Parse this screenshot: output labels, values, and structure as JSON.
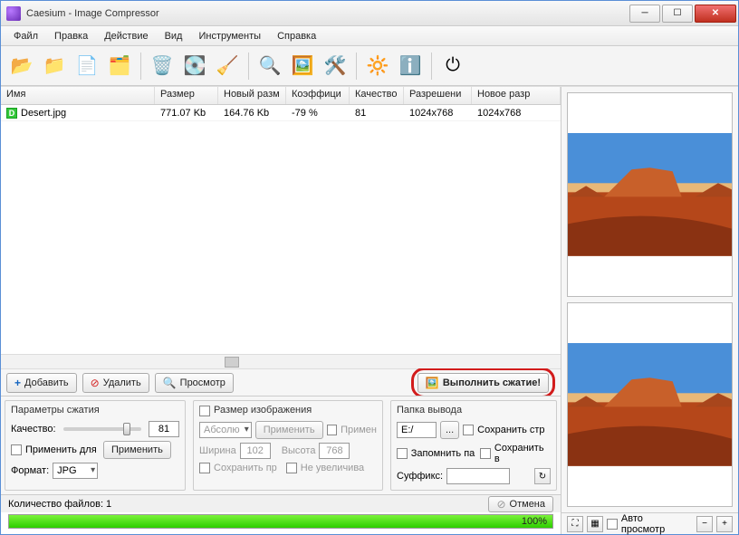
{
  "window": {
    "title": "Caesium - Image Compressor"
  },
  "menu": {
    "file": "Файл",
    "edit": "Правка",
    "action": "Действие",
    "view": "Вид",
    "tools": "Инструменты",
    "help": "Справка"
  },
  "columns": {
    "name": "Имя",
    "size": "Размер",
    "newsize": "Новый разм",
    "ratio": "Коэффици",
    "quality": "Качество",
    "resolution": "Разрешени",
    "newres": "Новое разр"
  },
  "rows": [
    {
      "name": "Desert.jpg",
      "size": "771.07 Kb",
      "newsize": "164.76 Kb",
      "ratio": "-79 %",
      "quality": "81",
      "resolution": "1024x768",
      "newres": "1024x768"
    }
  ],
  "buttons": {
    "add": "Добавить",
    "remove": "Удалить",
    "preview": "Просмотр",
    "compress": "Выполнить сжатие!"
  },
  "compression": {
    "title": "Параметры сжатия",
    "quality_label": "Качество:",
    "quality_value": "81",
    "apply_for": "Применить для",
    "apply": "Применить",
    "format_label": "Формат:",
    "format_value": "JPG"
  },
  "resize": {
    "title": "Размер изображения",
    "abs": "Абсолю",
    "applybtn": "Применить",
    "apply_chk": "Примен",
    "width_label": "Ширина",
    "width_value": "102",
    "height_label": "Высота",
    "height_value": "768",
    "keep": "Сохранить пр",
    "noenlarge": "Не увеличива"
  },
  "output": {
    "title": "Папка вывода",
    "path": "E:/",
    "browse": "...",
    "save_str": "Сохранить стр",
    "remember": "Запомнить па",
    "save_in": "Сохранить в",
    "suffix_label": "Суффикс:",
    "suffix_value": ""
  },
  "status": {
    "count_label": "Количество файлов: 1",
    "cancel": "Отмена",
    "progress_pct": "100%"
  },
  "preview": {
    "auto": "Авто просмотр"
  }
}
